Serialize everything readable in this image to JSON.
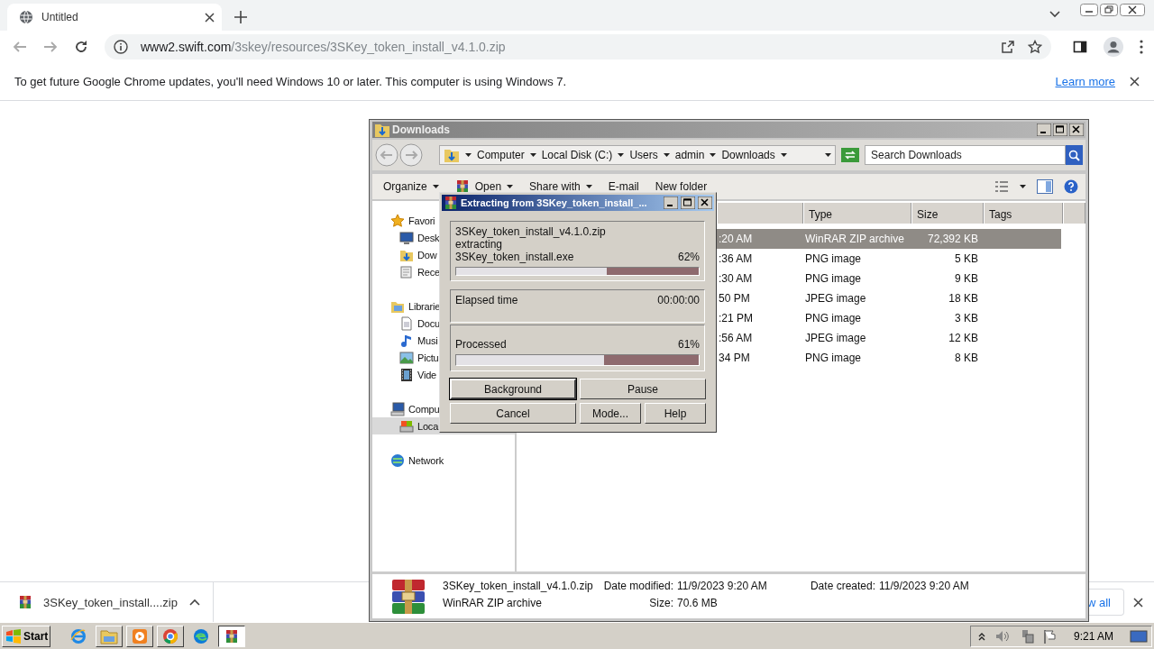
{
  "browser": {
    "tabs": [
      {
        "title": "Untitled",
        "selected": true
      }
    ],
    "address": {
      "host": "www2.swift.com",
      "path": "/3skey/resources/3SKey_token_install_v4.1.0.zip"
    },
    "infobar": {
      "message": "To get future Google Chrome updates, you'll need Windows 10 or later. This computer is using Windows 7.",
      "link": "Learn more"
    }
  },
  "explorer": {
    "title": "Downloads",
    "breadcrumb": [
      "Computer",
      "Local Disk (C:)",
      "Users",
      "admin",
      "Downloads"
    ],
    "search_placeholder": "Search Downloads",
    "toolbar": [
      {
        "label": "Organize",
        "menu": true,
        "icon": false
      },
      {
        "label": "Open",
        "menu": true,
        "icon": true
      },
      {
        "label": "Share with",
        "menu": true,
        "icon": false
      },
      {
        "label": "E-mail",
        "menu": false,
        "icon": false
      },
      {
        "label": "New folder",
        "menu": false,
        "icon": false
      }
    ],
    "sidebar": [
      {
        "label": "Favori",
        "kind": "favorites",
        "selected": false,
        "children": [
          {
            "label": "Desk",
            "kind": "desktop",
            "selected": false
          },
          {
            "label": "Dow",
            "kind": "downloads",
            "selected": false
          },
          {
            "label": "Rece",
            "kind": "recent",
            "selected": false
          }
        ]
      },
      {
        "label": "Librarie",
        "kind": "libraries",
        "selected": false,
        "children": [
          {
            "label": "Docu",
            "kind": "documents",
            "selected": false
          },
          {
            "label": "Musi",
            "kind": "music",
            "selected": false
          },
          {
            "label": "Pictu",
            "kind": "pictures",
            "selected": false
          },
          {
            "label": "Vide",
            "kind": "videos",
            "selected": false
          }
        ]
      },
      {
        "label": "Compu",
        "kind": "computer",
        "selected": false,
        "children": [
          {
            "label": "Loca",
            "kind": "disk",
            "selected": true
          }
        ]
      },
      {
        "label": "Network",
        "kind": "network",
        "selected": false
      }
    ],
    "columns": [
      "Type",
      "Size",
      "Tags"
    ],
    "rows": [
      {
        "date": ":20 AM",
        "type": "WinRAR ZIP archive",
        "size": "72,392 KB",
        "selected": true
      },
      {
        "date": ":36 AM",
        "type": "PNG image",
        "size": "5 KB",
        "selected": false
      },
      {
        "date": ":30 AM",
        "type": "PNG image",
        "size": "9 KB",
        "selected": false
      },
      {
        "date": "50 PM",
        "type": "JPEG image",
        "size": "18 KB",
        "selected": false
      },
      {
        "date": ":21 PM",
        "type": "PNG image",
        "size": "3 KB",
        "selected": false
      },
      {
        "date": ":56 AM",
        "type": "JPEG image",
        "size": "12 KB",
        "selected": false
      },
      {
        "date": "34 PM",
        "type": "PNG image",
        "size": "8 KB",
        "selected": false
      }
    ],
    "details": {
      "name": "3SKey_token_install_v4.1.0.zip",
      "type": "WinRAR ZIP archive",
      "modified_label": "Date modified:",
      "modified": "11/9/2023 9:20 AM",
      "size_label": "Size:",
      "size": "70.6 MB",
      "created_label": "Date created:",
      "created": "11/9/2023 9:20 AM"
    }
  },
  "dialog": {
    "title": "Extracting from 3SKey_token_install_...",
    "archive": "3SKey_token_install_v4.1.0.zip",
    "action": "extracting",
    "file": "3SKey_token_install.exe",
    "file_percent": "62%",
    "file_progress": {
      "level": 0.62
    },
    "elapsed_label": "Elapsed time",
    "elapsed": "00:00:00",
    "processed_label": "Processed",
    "processed_percent": "61%",
    "processed_progress": {
      "level": 0.61
    },
    "buttons": [
      {
        "label": "Background",
        "kind": "wide",
        "focused": true
      },
      {
        "label": "Pause",
        "kind": "wide",
        "focused": false
      },
      {
        "label": "Cancel",
        "kind": "wide",
        "focused": false
      },
      {
        "label": "Mode...",
        "kind": "narrow",
        "focused": false
      },
      {
        "label": "Help",
        "kind": "narrow",
        "focused": false
      }
    ]
  },
  "download_shelf": {
    "items": [
      {
        "name": "3SKey_token_install....zip"
      }
    ],
    "show_all": "w all"
  },
  "taskbar": {
    "start": "Start",
    "apps": [
      {
        "kind": "ie",
        "selected": false
      },
      {
        "kind": "folder",
        "selected": false
      },
      {
        "kind": "media",
        "selected": false
      },
      {
        "kind": "chrome",
        "selected": false
      },
      {
        "kind": "edge",
        "selected": false
      },
      {
        "kind": "winrar",
        "selected": true
      }
    ],
    "clock": "9:21 AM"
  }
}
